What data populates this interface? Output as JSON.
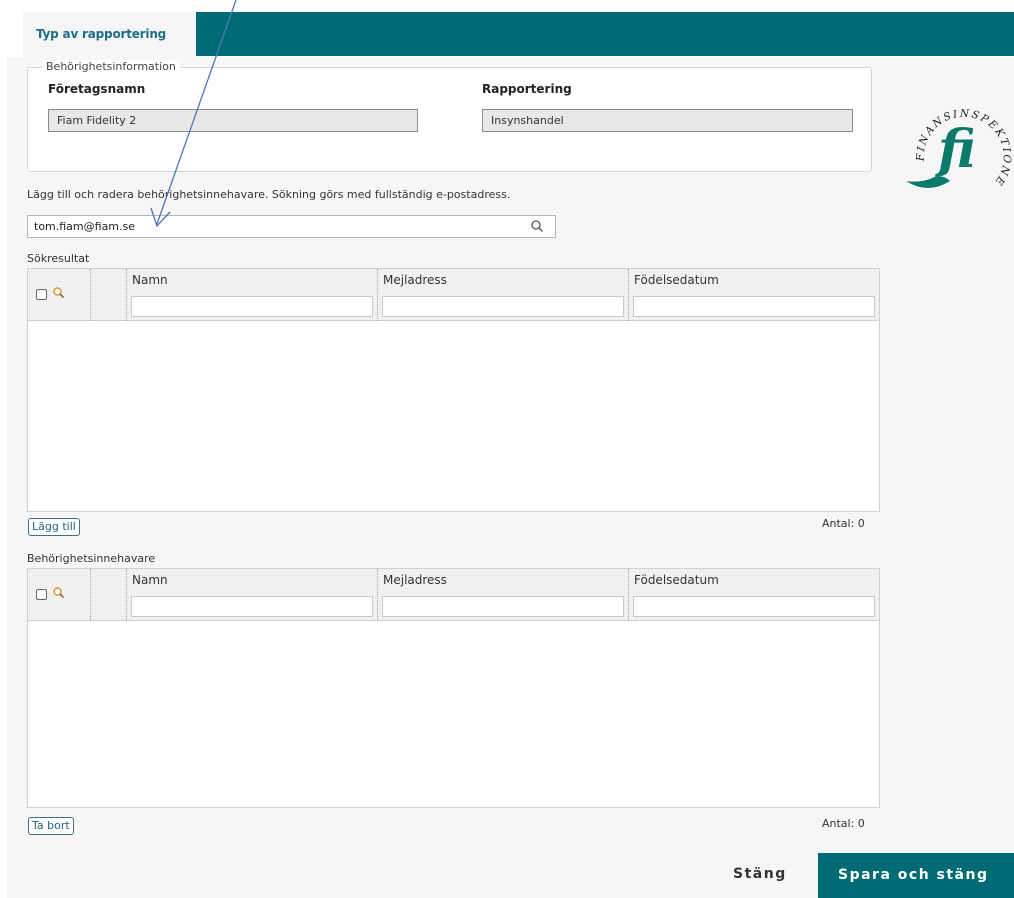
{
  "tabs": {
    "active": "Typ av rapportering"
  },
  "fieldset": {
    "legend": "Behörighetsinformation",
    "company_label": "Företagsnamn",
    "company_value": "Fiam Fidelity 2",
    "reporting_label": "Rapportering",
    "reporting_value": "Insynshandel"
  },
  "instruction": "Lägg till och radera behörighetsinnehavare. Sökning görs med fullständig e-postadress.",
  "search": {
    "value": "tom.fiam@fiam.se"
  },
  "results": {
    "label": "Sökresultat",
    "columns": [
      "Namn",
      "Mejladress",
      "Födelsedatum"
    ],
    "add_button": "Lägg till",
    "count": "Antal: 0"
  },
  "holders": {
    "label": "Behörighetsinnehavare",
    "columns": [
      "Namn",
      "Mejladress",
      "Födelsedatum"
    ],
    "remove_button": "Ta bort",
    "count": "Antal: 0"
  },
  "footer": {
    "close": "Stäng",
    "save": "Spara och stäng"
  },
  "logo": {
    "text": "FINANSINSPEKTIONEN",
    "mark": "fi"
  },
  "colors": {
    "brand": "#006b74",
    "arrow": "#4a78b5"
  }
}
